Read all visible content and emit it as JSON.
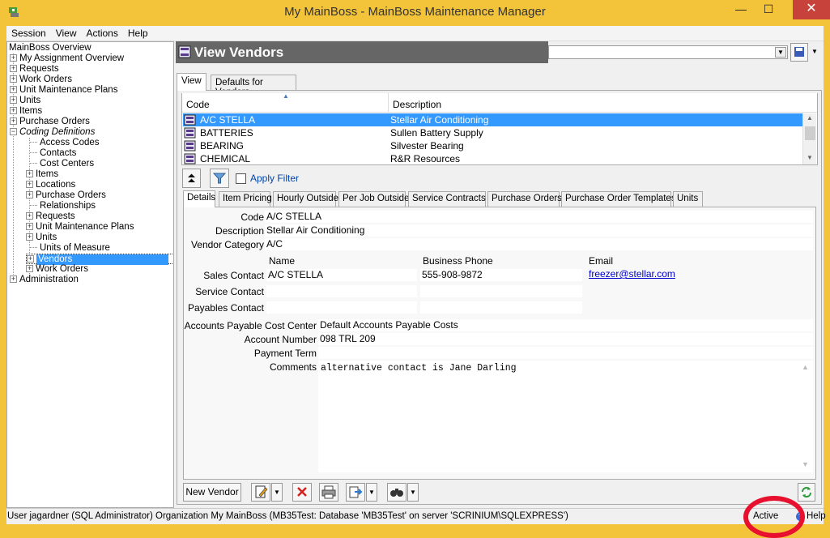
{
  "window": {
    "title": "My MainBoss - MainBoss Maintenance Manager",
    "minimize_glyph": "—",
    "maximize_glyph": "☐",
    "close_glyph": "✕"
  },
  "menu": [
    "Session",
    "View",
    "Actions",
    "Help"
  ],
  "tree": {
    "root": "MainBoss Overview",
    "items": [
      "My Assignment Overview",
      "Requests",
      "Work Orders",
      "Unit Maintenance Plans",
      "Units",
      "Items",
      "Purchase Orders",
      "Coding Definitions",
      "Access Codes",
      "Contacts",
      "Cost Centers",
      "Items",
      "Locations",
      "Purchase Orders",
      "Relationships",
      "Requests",
      "Unit Maintenance Plans",
      "Units",
      "Units of Measure",
      "Vendors",
      "Work Orders",
      "Administration"
    ]
  },
  "header": {
    "title": "View Vendors",
    "combo_value": ""
  },
  "outer_tabs": [
    "View",
    "Defaults for Vendors"
  ],
  "list": {
    "columns": [
      "Code",
      "Description"
    ],
    "rows": [
      {
        "code": "A/C STELLA",
        "desc": "Stellar Air Conditioning"
      },
      {
        "code": "BATTERIES",
        "desc": "Sullen Battery Supply"
      },
      {
        "code": "BEARING",
        "desc": "Silvester Bearing"
      },
      {
        "code": "CHEMICAL",
        "desc": "R&R Resources"
      }
    ]
  },
  "filter": {
    "apply_filter_label": "Apply Filter"
  },
  "detail_tabs": [
    "Details",
    "Item Pricing",
    "Hourly Outside",
    "Per Job Outside",
    "Service Contracts",
    "Purchase Orders",
    "Purchase Order Templates",
    "Units"
  ],
  "details": {
    "code_label": "Code",
    "code_value": "A/C STELLA",
    "description_label": "Description",
    "description_value": "Stellar Air Conditioning",
    "vendor_category_label": "Vendor Category",
    "vendor_category_value": "A/C",
    "col_name": "Name",
    "col_phone": "Business Phone",
    "col_email": "Email",
    "sales_contact_label": "Sales Contact",
    "sales_contact_name": "A/C STELLA",
    "sales_contact_phone": "555-908-9872",
    "sales_contact_email": "freezer@stellar.com",
    "service_contact_label": "Service Contact",
    "payables_contact_label": "Payables Contact",
    "ap_cost_center_label": "Accounts Payable Cost Center",
    "ap_cost_center_value": "Default Accounts Payable Costs",
    "account_number_label": "Account Number",
    "account_number_value": "098 TRL 209",
    "payment_term_label": "Payment Term",
    "payment_term_value": "",
    "comments_label": "Comments",
    "comments_value": "alternative contact is Jane Darling"
  },
  "toolbar": {
    "new_vendor_label": "New Vendor"
  },
  "status": {
    "text": "User jagardner (SQL Administrator) Organization My MainBoss (MB35Test: Database 'MB35Test' on server 'SCRINIUM\\SQLEXPRESS')",
    "active": "Active",
    "help": "Help"
  },
  "colors": {
    "titlebar": "#f3c33a",
    "selection": "#3399ff",
    "close": "#c7423b",
    "highlight_ring": "#e8102f"
  }
}
